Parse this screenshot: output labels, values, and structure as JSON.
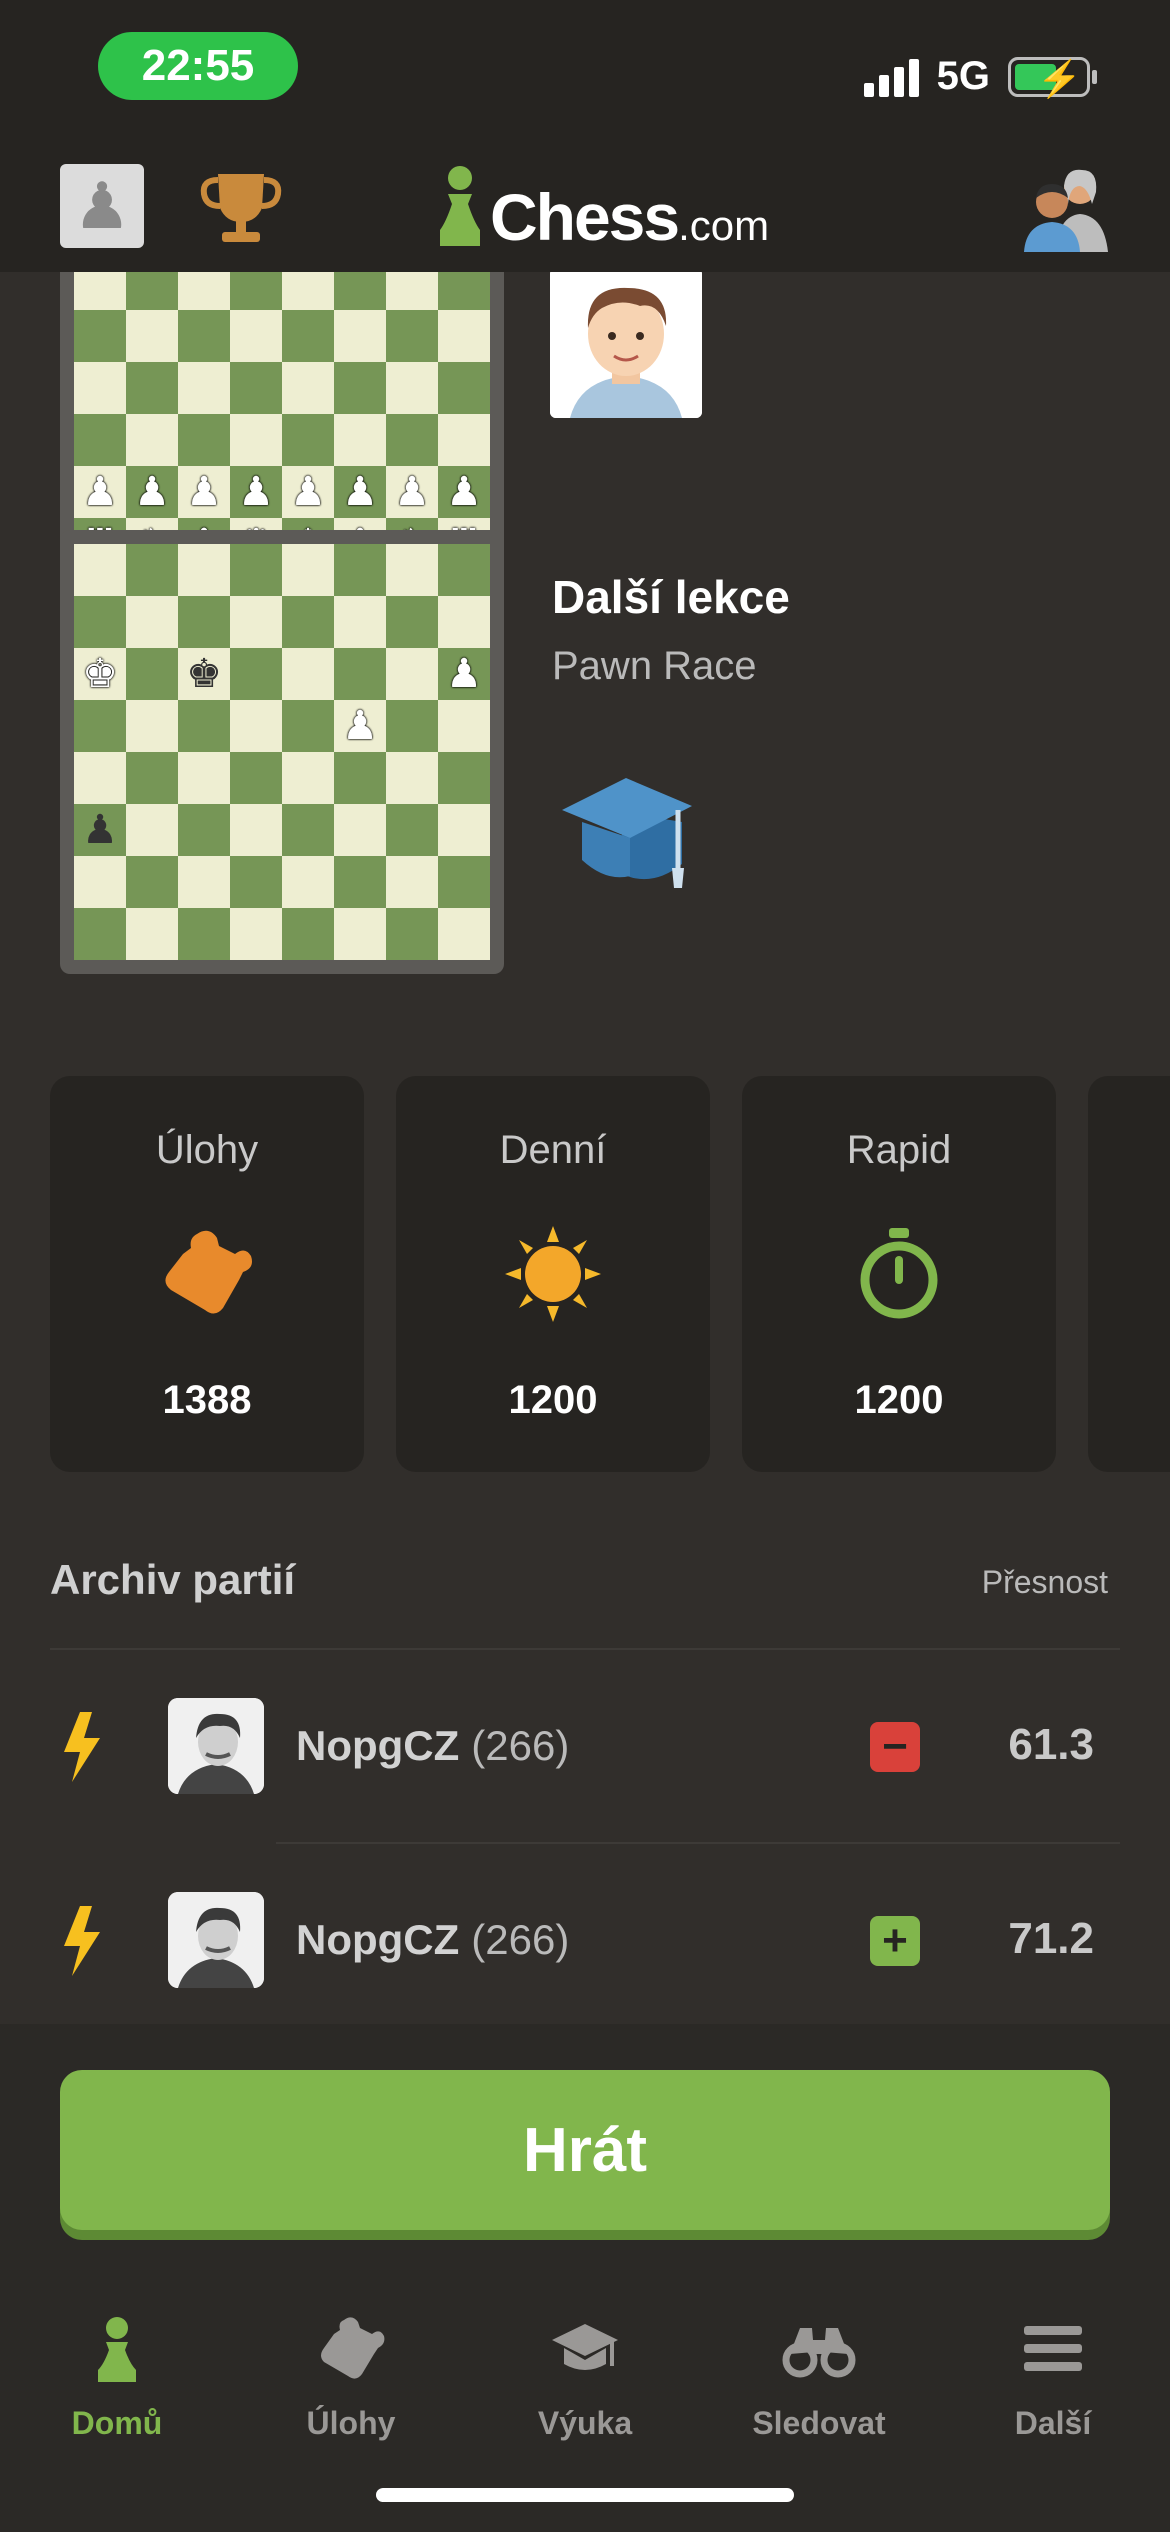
{
  "status_bar": {
    "time": "22:55",
    "network": "5G"
  },
  "header": {
    "logo_text": "Chess",
    "logo_suffix": ".com"
  },
  "lesson": {
    "title": "Další lekce",
    "subtitle": "Pawn Race"
  },
  "ratings": [
    {
      "label": "Úlohy",
      "value": "1388",
      "icon": "puzzle-icon"
    },
    {
      "label": "Denní",
      "value": "1200",
      "icon": "sun-icon"
    },
    {
      "label": "Rapid",
      "value": "1200",
      "icon": "stopwatch-icon"
    }
  ],
  "archive": {
    "title": "Archiv partií",
    "accuracy_label": "Přesnost",
    "games": [
      {
        "player": "NopgCZ",
        "rating": "(266)",
        "result": "loss",
        "result_symbol": "−",
        "accuracy": "61.3"
      },
      {
        "player": "NopgCZ",
        "rating": "(266)",
        "result": "win",
        "result_symbol": "+",
        "accuracy": "71.2"
      }
    ]
  },
  "play_button": "Hrát",
  "nav": [
    {
      "label": "Domů",
      "icon": "pawn-icon",
      "active": true
    },
    {
      "label": "Úlohy",
      "icon": "puzzle-icon",
      "active": false
    },
    {
      "label": "Výuka",
      "icon": "graduation-cap-icon",
      "active": false
    },
    {
      "label": "Sledovat",
      "icon": "binoculars-icon",
      "active": false
    },
    {
      "label": "Další",
      "icon": "menu-icon",
      "active": false
    }
  ],
  "colors": {
    "accent": "#81b64c",
    "background": "#312e2b",
    "card": "#262421",
    "loss": "#d9413a",
    "win": "#81b64c"
  }
}
